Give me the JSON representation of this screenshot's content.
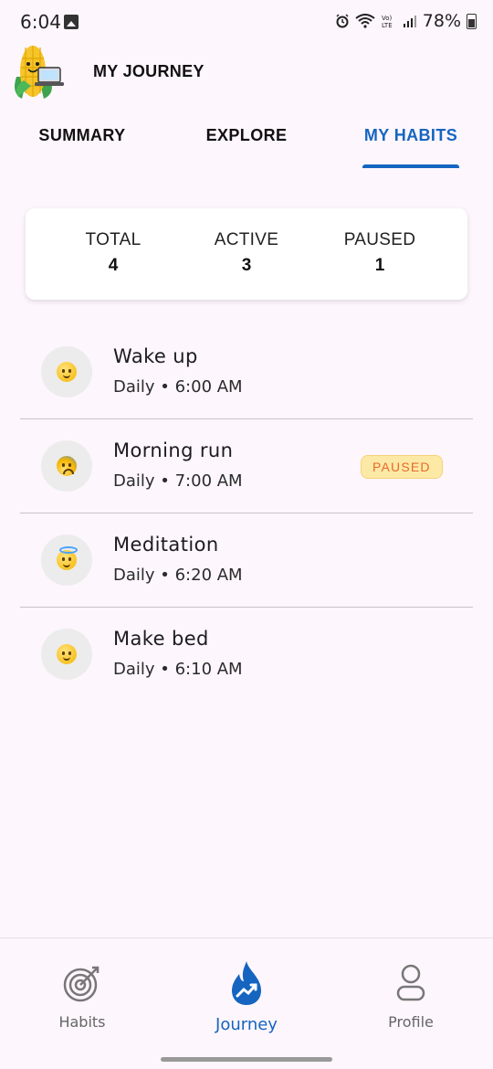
{
  "status_bar": {
    "time": "6:04",
    "battery": "78%",
    "icons": [
      "gallery-icon",
      "alarm-icon",
      "wifi-icon",
      "volte-icon",
      "signal-icon",
      "battery-icon"
    ]
  },
  "app_bar": {
    "title": "MY JOURNEY",
    "logo": "corn-mascot-logo"
  },
  "tabs": [
    {
      "label": "SUMMARY",
      "active": false
    },
    {
      "label": "EXPLORE",
      "active": false
    },
    {
      "label": "MY HABITS",
      "active": true
    }
  ],
  "stats": {
    "total": {
      "label": "TOTAL",
      "value": "4"
    },
    "active": {
      "label": "ACTIVE",
      "value": "3"
    },
    "paused": {
      "label": "PAUSED",
      "value": "1"
    }
  },
  "habits": [
    {
      "name": "Wake up",
      "schedule": "Daily • 6:00 AM",
      "emoji": "slightly-smiling-face",
      "badge": ""
    },
    {
      "name": "Morning run",
      "schedule": "Daily • 7:00 AM",
      "emoji": "anxious-face",
      "badge": "PAUSED"
    },
    {
      "name": "Meditation",
      "schedule": "Daily • 6:20 AM",
      "emoji": "smiling-face-with-halo",
      "badge": ""
    },
    {
      "name": "Make bed",
      "schedule": "Daily • 6:10 AM",
      "emoji": "slightly-smiling-face",
      "badge": ""
    }
  ],
  "bottom_nav": [
    {
      "label": "Habits",
      "icon": "target-icon",
      "active": false
    },
    {
      "label": "Journey",
      "icon": "flame-trend-icon",
      "active": true
    },
    {
      "label": "Profile",
      "icon": "person-icon",
      "active": false
    }
  ],
  "colors": {
    "accent": "#1565c0",
    "background": "#fdf6fc",
    "badge_bg": "#fde9a6",
    "badge_text": "#e8692a"
  }
}
